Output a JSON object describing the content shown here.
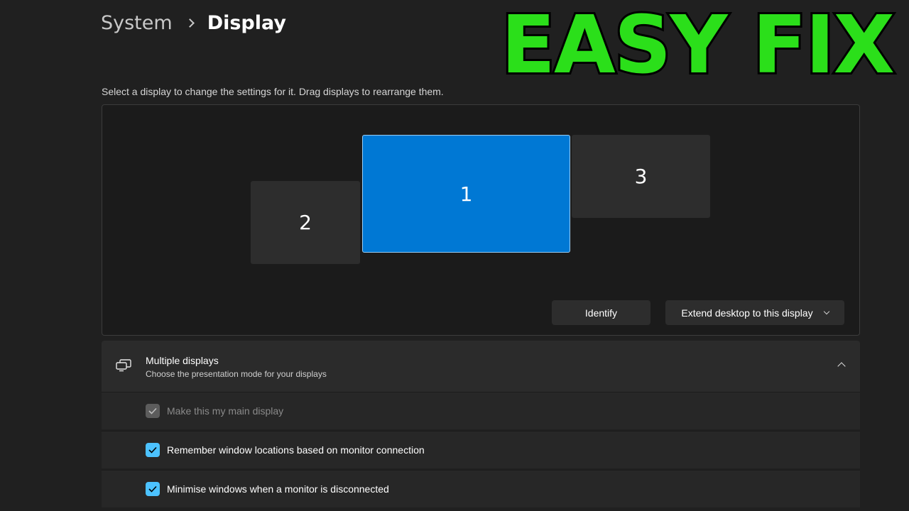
{
  "breadcrumb": {
    "parent": "System",
    "current": "Display"
  },
  "overlay": {
    "text": "EASY FIX",
    "color": "#2bdf1a"
  },
  "arrangement": {
    "instructions": "Select a display to change the settings for it. Drag displays to rearrange them.",
    "monitors": [
      {
        "label": "1",
        "selected": true
      },
      {
        "label": "2",
        "selected": false
      },
      {
        "label": "3",
        "selected": false
      }
    ],
    "identify_label": "Identify",
    "mode_dropdown_value": "Extend desktop to this display",
    "accent_color": "#0078d4"
  },
  "multiple_displays": {
    "icon": "multiple-displays-icon",
    "title": "Multiple displays",
    "subtitle": "Choose the presentation mode for your displays",
    "expanded": true,
    "options": [
      {
        "label": "Make this my main display",
        "checked": true,
        "disabled": true
      },
      {
        "label": "Remember window locations based on monitor connection",
        "checked": true,
        "disabled": false
      },
      {
        "label": "Minimise windows when a monitor is disconnected",
        "checked": true,
        "disabled": false
      }
    ]
  }
}
